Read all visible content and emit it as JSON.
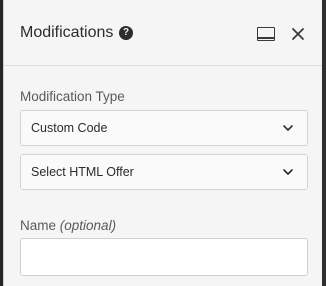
{
  "panel": {
    "title": "Modifications",
    "help_icon": "question-circle-icon",
    "dock_icon": "dock-panel-icon",
    "close_icon": "close-icon"
  },
  "modification_type": {
    "label": "Modification Type",
    "selected": "Custom Code"
  },
  "offer_select": {
    "selected": "Select HTML Offer"
  },
  "name_field": {
    "label": "Name",
    "label_suffix": "(optional)",
    "value": "",
    "placeholder": ""
  }
}
